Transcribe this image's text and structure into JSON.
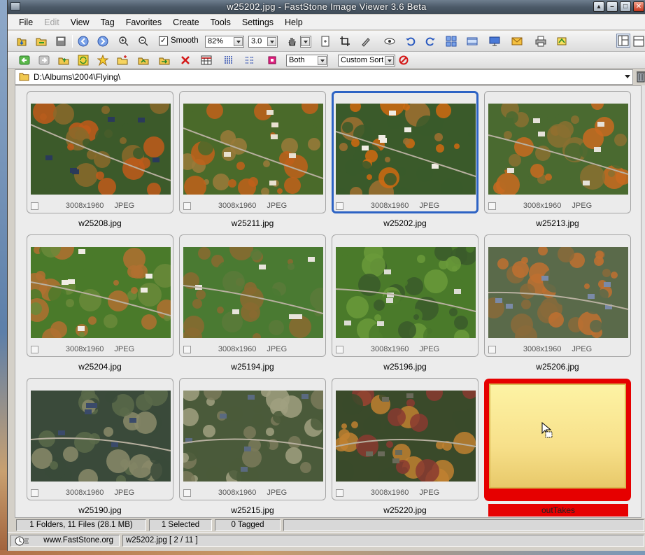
{
  "window": {
    "title": "w25202.jpg  -  FastStone Image Viewer 3.6 Beta",
    "controls": [
      "minimize",
      "restore",
      "maximize",
      "close"
    ]
  },
  "menu": [
    "File",
    "Edit",
    "View",
    "Tag",
    "Favorites",
    "Create",
    "Tools",
    "Settings",
    "Help"
  ],
  "toolbar": {
    "smooth_label": "Smooth",
    "smooth_checked": true,
    "zoom_value": "82%",
    "step_value": "3.0"
  },
  "toolbar2": {
    "filter_value": "Both",
    "sort_value": "Custom Sort"
  },
  "address": {
    "path": "D:\\Albums\\2004\\Flying\\"
  },
  "thumbnails": [
    {
      "filename": "w25208.jpg",
      "dims": "3008x1960",
      "format": "JPEG",
      "selected": false
    },
    {
      "filename": "w25211.jpg",
      "dims": "3008x1960",
      "format": "JPEG",
      "selected": false
    },
    {
      "filename": "w25202.jpg",
      "dims": "3008x1960",
      "format": "JPEG",
      "selected": true
    },
    {
      "filename": "w25213.jpg",
      "dims": "3008x1960",
      "format": "JPEG",
      "selected": false
    },
    {
      "filename": "w25204.jpg",
      "dims": "3008x1960",
      "format": "JPEG",
      "selected": false
    },
    {
      "filename": "w25194.jpg",
      "dims": "3008x1960",
      "format": "JPEG",
      "selected": false
    },
    {
      "filename": "w25196.jpg",
      "dims": "3008x1960",
      "format": "JPEG",
      "selected": false
    },
    {
      "filename": "w25206.jpg",
      "dims": "3008x1960",
      "format": "JPEG",
      "selected": false
    },
    {
      "filename": "w25190.jpg",
      "dims": "3008x1960",
      "format": "JPEG",
      "selected": false
    },
    {
      "filename": "w25215.jpg",
      "dims": "3008x1960",
      "format": "JPEG",
      "selected": false
    },
    {
      "filename": "w25220.jpg",
      "dims": "3008x1960",
      "format": "JPEG",
      "selected": false
    }
  ],
  "folder_item": {
    "name": "outTakes"
  },
  "status": {
    "files": "1 Folders, 11 Files (28.1 MB)",
    "selected": "1 Selected",
    "tagged": "0 Tagged",
    "website": "www.FastStone.org",
    "current": "w25202.jpg [ 2 / 11 ]"
  },
  "colors": {
    "selection_border": "#2d63c4",
    "folder_highlight": "#e60000",
    "folder_fill": "#f9e88f"
  }
}
